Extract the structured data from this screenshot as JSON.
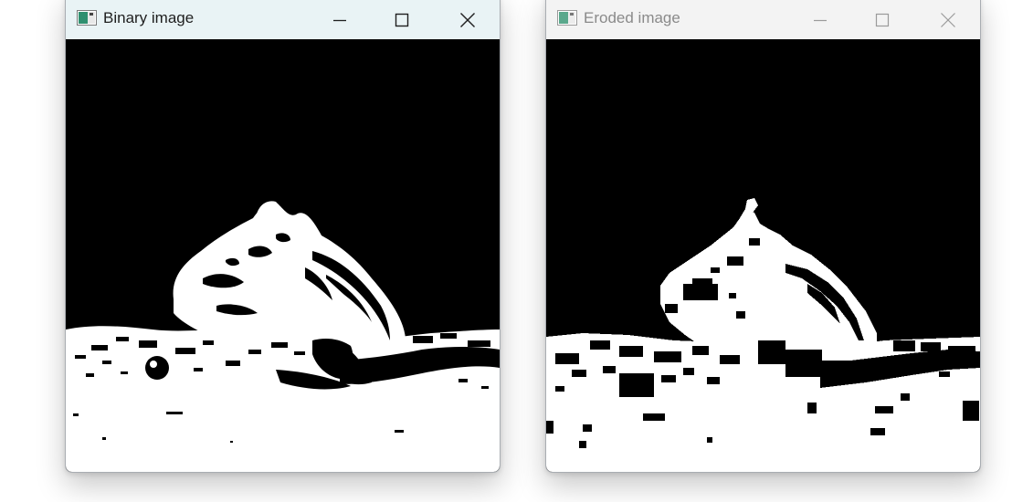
{
  "windows": [
    {
      "title": "Binary image",
      "state": "active",
      "icon": "app-icon",
      "controls": [
        "minimize-icon",
        "maximize-icon",
        "close-icon"
      ],
      "content": "binary-threshold-image"
    },
    {
      "title": "Eroded image",
      "state": "inactive",
      "icon": "app-icon",
      "controls": [
        "minimize-icon",
        "maximize-icon",
        "close-icon"
      ],
      "content": "eroded-image"
    }
  ],
  "colors": {
    "active_titlebar": "#e9f3f5",
    "inactive_titlebar": "#f3f3f3",
    "active_title_text": "#1f1f1f",
    "inactive_title_text": "#8a8a8a",
    "image_foreground": "#ffffff",
    "image_background": "#000000"
  }
}
